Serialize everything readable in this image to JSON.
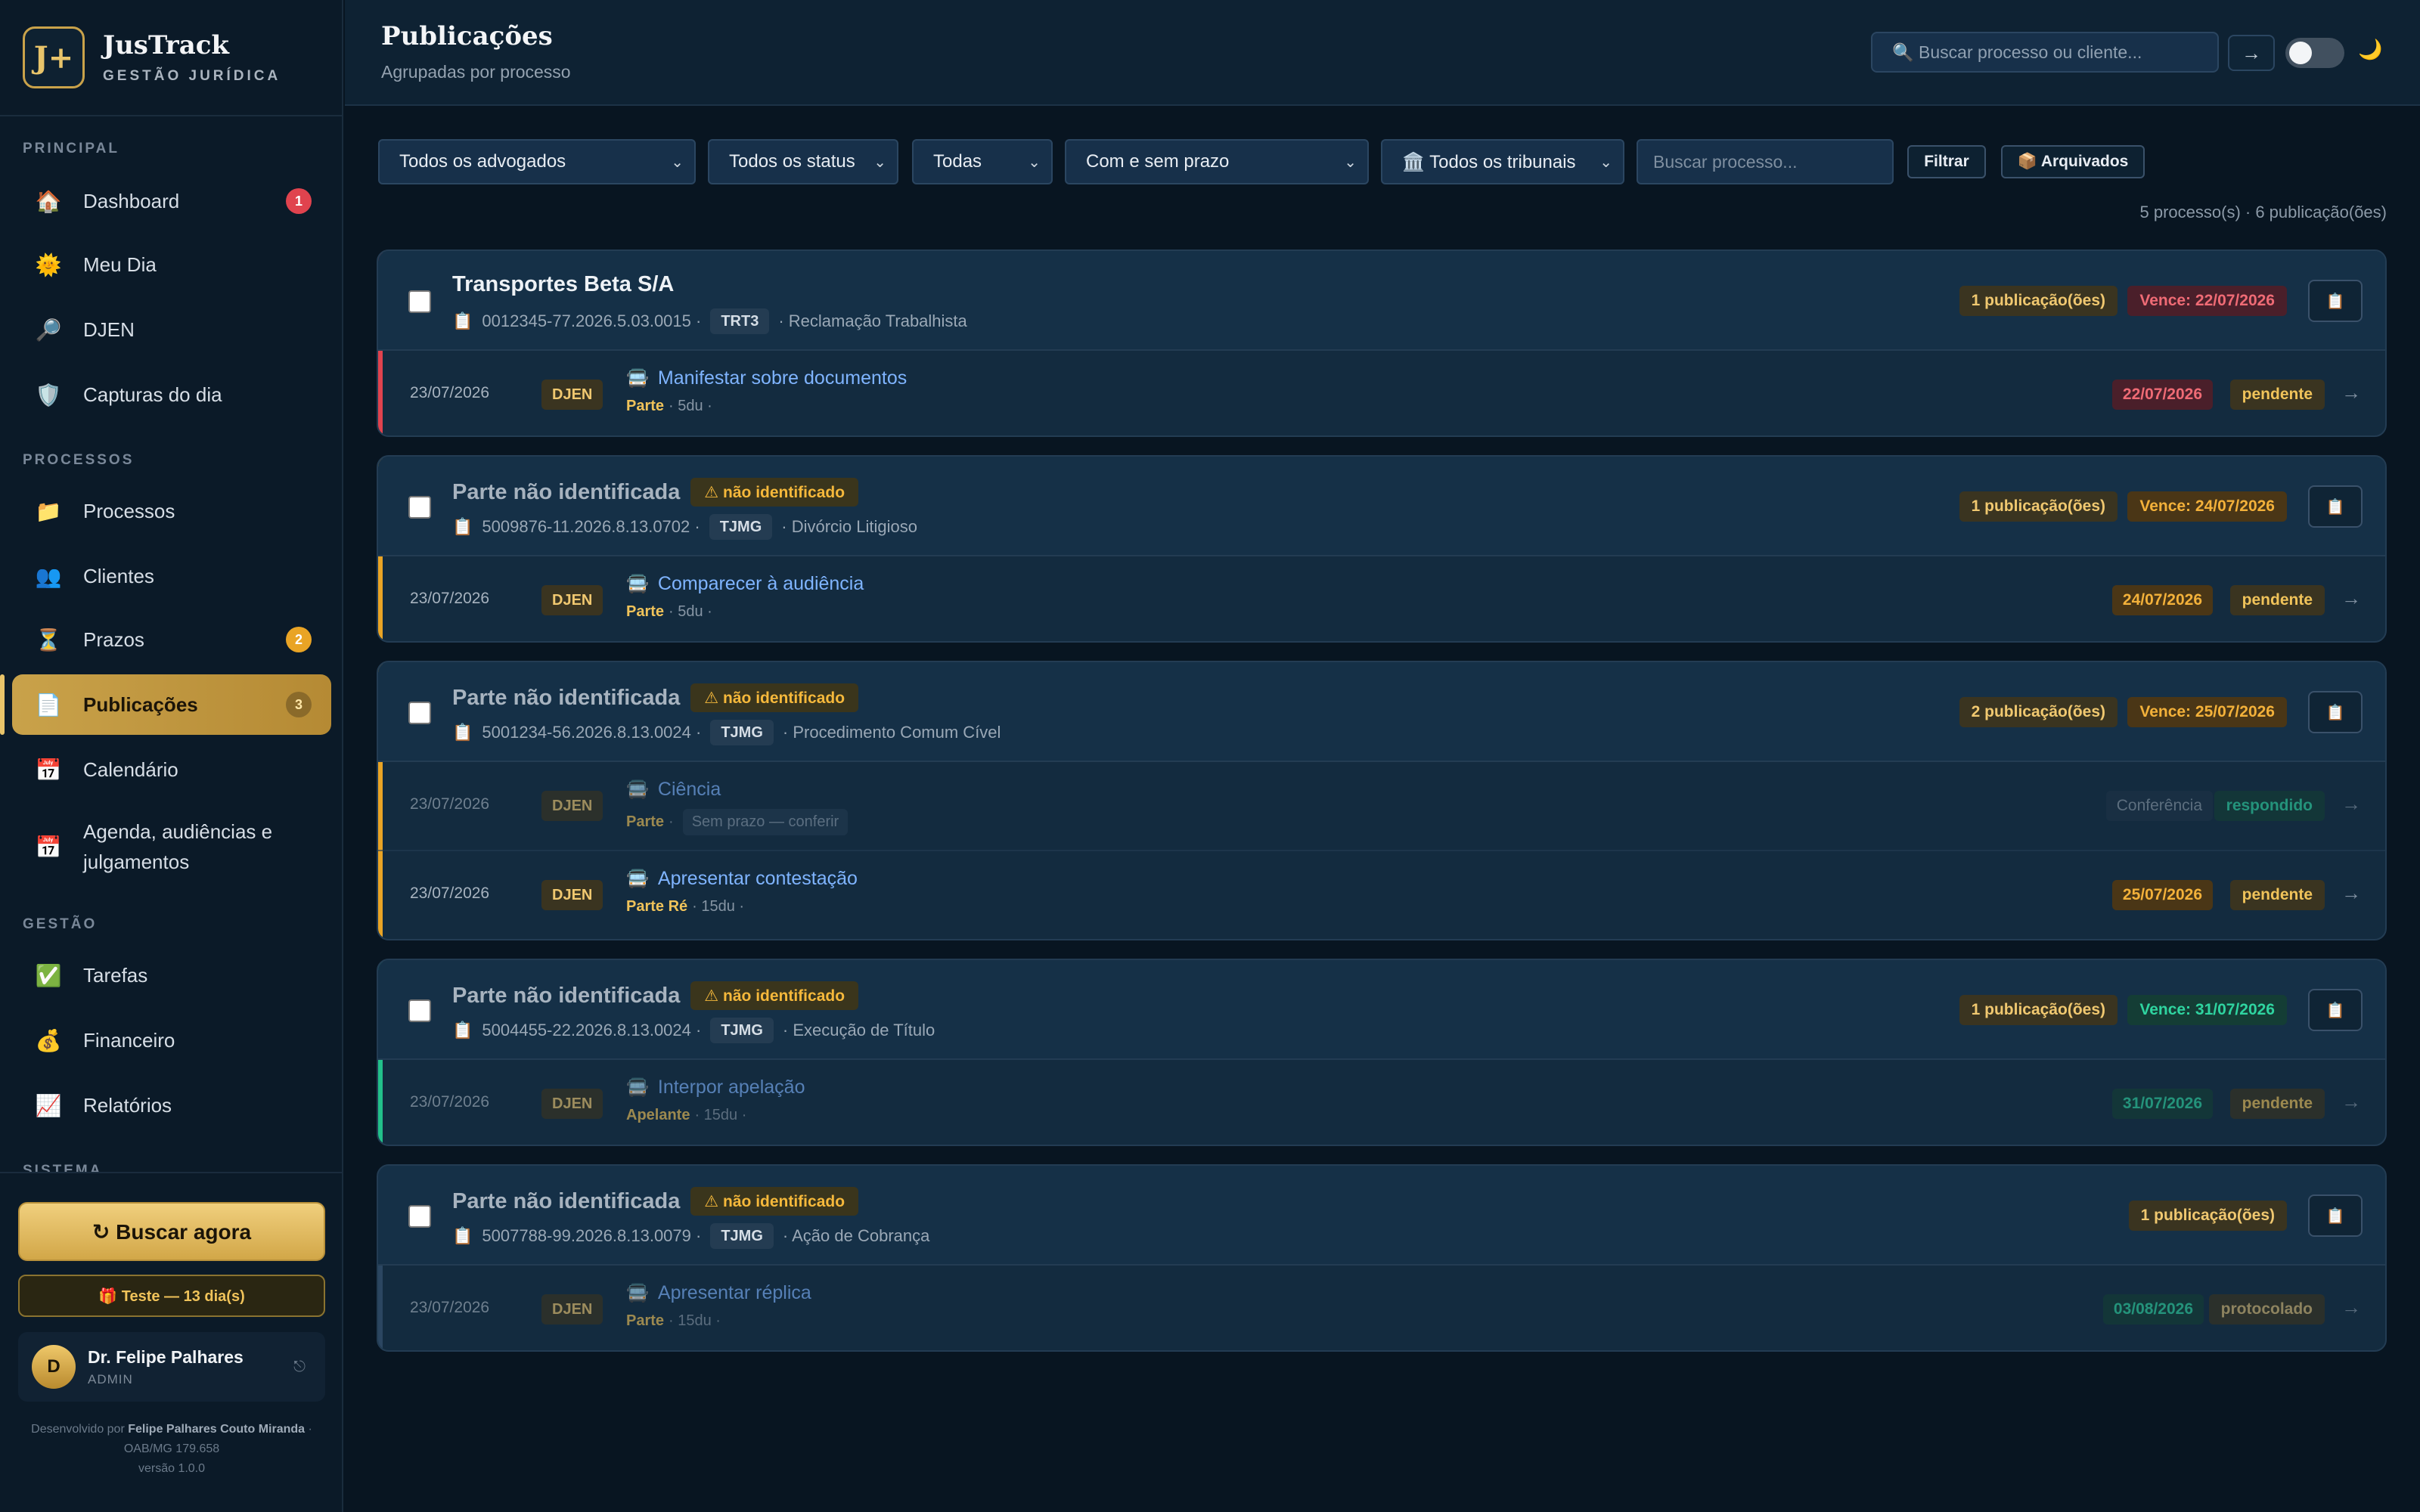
{
  "brand": {
    "name": "JusTrack",
    "subtitle": "GESTÃO JURÍDICA",
    "logo": "J+"
  },
  "sidebar": {
    "sections": {
      "principal": "PRINCIPAL",
      "processos": "PROCESSOS",
      "gestao": "GESTÃO",
      "sistema": "SISTEMA"
    },
    "items": [
      {
        "label": "Dashboard",
        "icon": "🏠",
        "badge": "1"
      },
      {
        "label": "Meu Dia",
        "icon": "🌞",
        "badge": ""
      },
      {
        "label": "DJEN",
        "icon": "🔎",
        "badge": ""
      },
      {
        "label": "Capturas do dia",
        "icon": "🛡️",
        "badge": ""
      },
      {
        "label": "Processos",
        "icon": "📁",
        "badge": ""
      },
      {
        "label": "Clientes",
        "icon": "👥",
        "badge": ""
      },
      {
        "label": "Prazos",
        "icon": "⏳",
        "badge": "2"
      },
      {
        "label": "Publicações",
        "icon": "📄",
        "badge": "3"
      },
      {
        "label": "Calendário",
        "icon": "📅",
        "badge": ""
      },
      {
        "label": "Agenda, audiências e julgamentos",
        "icon": "📅",
        "badge": ""
      },
      {
        "label": "Tarefas",
        "icon": "✅",
        "badge": ""
      },
      {
        "label": "Financeiro",
        "icon": "💰",
        "badge": ""
      },
      {
        "label": "Relatórios",
        "icon": "📈",
        "badge": ""
      }
    ],
    "buscar": "↻ Buscar agora",
    "teste": "🎁 Teste — 13 dia(s)",
    "user": {
      "initial": "D",
      "name": "Dr. Felipe Palhares",
      "role": "ADMIN",
      "logout_icon": "⎋"
    },
    "credit": {
      "prefix": "Desenvolvido por",
      "author": "Felipe Palhares Couto Miranda",
      "oab": "· OAB/MG 179.658",
      "version": "versão 1.0.0"
    }
  },
  "header": {
    "title": "Publicações",
    "subtitle": "Agrupadas por processo",
    "search_placeholder": "🔍 Buscar processo ou cliente...",
    "go": "→",
    "moon": "🌙"
  },
  "filters": {
    "advogados": "Todos os advogados",
    "status": "Todos os status",
    "todas": "Todas",
    "prazo": "Com e sem prazo",
    "tribunais": "🏛️ Todos os tribunais",
    "search_placeholder": "Buscar processo...",
    "filtrar": "Filtrar",
    "arquivados": "📦 Arquivados"
  },
  "count": "5 processo(s) · 6 publicação(ões)",
  "groups": [
    {
      "client": "Transportes Beta S/A",
      "warn": "",
      "process": "0012345-77.2026.5.03.0015 ·",
      "tribunal": "TRT3",
      "tipo": "· Reclamação Trabalhista",
      "pubs": "1 publicação(ões)",
      "vence": "Vence: 22/07/2026",
      "color": "#e0434e",
      "rows": [
        {
          "date": "23/07/2026",
          "source": "DJEN",
          "action": "Manifestar sobre documentos",
          "role": "Parte",
          "meta": "· 5du ·",
          "np": "",
          "due": "22/07/2026",
          "status": "pendente"
        }
      ]
    },
    {
      "client": "Parte não identificada",
      "warn": "⚠ não identificado",
      "process": "5009876-11.2026.8.13.0702 ·",
      "tribunal": "TJMG",
      "tipo": "· Divórcio Litigioso",
      "pubs": "1 publicação(ões)",
      "vence": "Vence: 24/07/2026",
      "color": "#e9a425",
      "rows": [
        {
          "date": "23/07/2026",
          "source": "DJEN",
          "action": "Comparecer à audiência",
          "role": "Parte",
          "meta": "· 5du ·",
          "np": "",
          "due": "24/07/2026",
          "status": "pendente"
        }
      ]
    },
    {
      "client": "Parte não identificada",
      "warn": "⚠ não identificado",
      "process": "5001234-56.2026.8.13.0024 ·",
      "tribunal": "TJMG",
      "tipo": "· Procedimento Comum Cível",
      "pubs": "2 publicação(ões)",
      "vence": "Vence: 25/07/2026",
      "color": "#e9a425",
      "rows": [
        {
          "date": "23/07/2026",
          "source": "DJEN",
          "action": "Ciência",
          "role": "Parte",
          "meta": "·",
          "np": "Sem prazo — conferir",
          "due": "Conferência",
          "status": "respondido"
        },
        {
          "date": "23/07/2026",
          "source": "DJEN",
          "action": "Apresentar contestação",
          "role": "Parte Ré",
          "meta": "· 15du ·",
          "np": "",
          "due": "25/07/2026",
          "status": "pendente"
        }
      ]
    },
    {
      "client": "Parte não identificada",
      "warn": "⚠ não identificado",
      "process": "5004455-22.2026.8.13.0024 ·",
      "tribunal": "TJMG",
      "tipo": "· Execução de Título",
      "pubs": "1 publicação(ões)",
      "vence": "Vence: 31/07/2026",
      "color": "#22c08a",
      "rows": [
        {
          "date": "23/07/2026",
          "source": "DJEN",
          "action": "Interpor apelação",
          "role": "Apelante",
          "meta": "· 15du ·",
          "np": "",
          "due": "31/07/2026",
          "status": "pendente"
        }
      ]
    },
    {
      "client": "Parte não identificada",
      "warn": "⚠ não identificado",
      "process": "5007788-99.2026.8.13.0079 ·",
      "tribunal": "TJMG",
      "tipo": "· Ação de Cobrança",
      "pubs": "1 publicação(ões)",
      "vence": "",
      "color": "#2b4661",
      "rows": [
        {
          "date": "23/07/2026",
          "source": "DJEN",
          "action": "Apresentar réplica",
          "role": "Parte",
          "meta": "· 15du ·",
          "np": "",
          "due": "03/08/2026",
          "status": "protocolado"
        }
      ]
    }
  ],
  "icons": {
    "clipboard": "📋",
    "action": "🚍",
    "arrow": "→"
  }
}
